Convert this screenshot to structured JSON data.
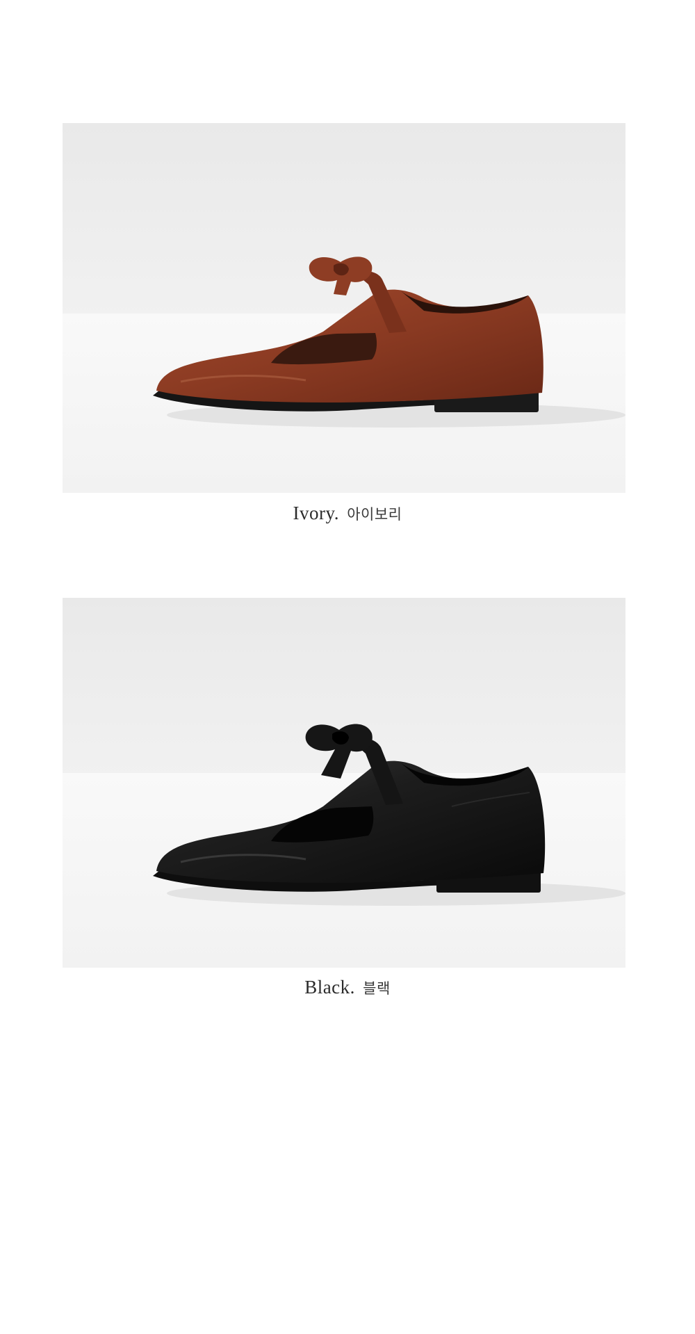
{
  "products": [
    {
      "caption_en": "Ivory.",
      "caption_ko": "아이보리",
      "shoe_color": "#8a3a22",
      "shoe_shade": "#5e2414",
      "shoe_icon": "t-strap-bow-loafer"
    },
    {
      "caption_en": "Black.",
      "caption_ko": "블랙",
      "shoe_color": "#1d1d1d",
      "shoe_shade": "#080808",
      "shoe_icon": "t-strap-bow-loafer"
    }
  ],
  "background": {
    "wall": "#ececec",
    "floor": "#f7f7f7",
    "page": "#ffffff"
  }
}
